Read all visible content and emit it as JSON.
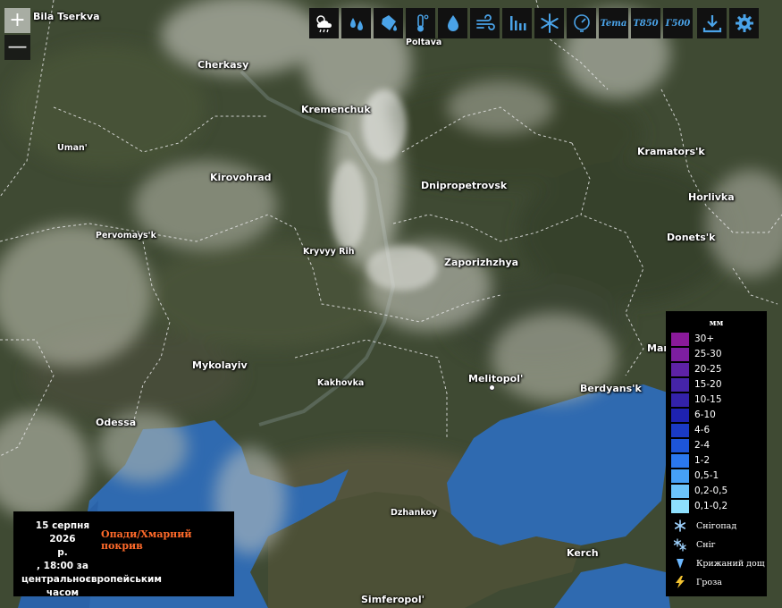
{
  "map": {
    "cities": [
      {
        "name": "Bila Tserkva"
      },
      {
        "name": "Poltava"
      },
      {
        "name": "Cherkasy"
      },
      {
        "name": "Kremenchuk"
      },
      {
        "name": "Uman'"
      },
      {
        "name": "Kirovohrad"
      },
      {
        "name": "Dnipropetrovsk"
      },
      {
        "name": "Kramators'k"
      },
      {
        "name": "Horlivka"
      },
      {
        "name": "Donets'k"
      },
      {
        "name": "Pervomays'k"
      },
      {
        "name": "Kryvyy Rih"
      },
      {
        "name": "Zaporizhzhya"
      },
      {
        "name": "Mykolayiv"
      },
      {
        "name": "Kakhovka"
      },
      {
        "name": "Melitopol'"
      },
      {
        "name": "Berdyans'k"
      },
      {
        "name": "Odessa"
      },
      {
        "name": "Dzhankoy"
      },
      {
        "name": "Kerch"
      },
      {
        "name": "Simferopol'"
      },
      {
        "name": "Mar"
      }
    ]
  },
  "zoom": {
    "in_label": "+",
    "out_label": "—"
  },
  "toolbar": {
    "items": [
      {
        "icon": "sun-cloud-rain-icon"
      },
      {
        "icon": "raindrops-icon"
      },
      {
        "icon": "bucket-icon"
      },
      {
        "icon": "thermometer-icon"
      },
      {
        "icon": "humidity-drop-icon"
      },
      {
        "icon": "wind-icon"
      },
      {
        "icon": "pressure-bars-icon"
      },
      {
        "icon": "snowflake-icon"
      },
      {
        "icon": "gauge-icon"
      },
      {
        "label": "Tema"
      },
      {
        "label": "T850"
      },
      {
        "label": "Г500"
      },
      {
        "icon": "download-icon"
      },
      {
        "icon": "settings-gear-icon"
      }
    ],
    "accent": "#4aa3e8"
  },
  "legend": {
    "unit": "мм",
    "scale": [
      {
        "label": "30+",
        "color": "#8a1a9a"
      },
      {
        "label": "25-30",
        "color": "#7d1ea0"
      },
      {
        "label": "20-25",
        "color": "#5e22a6"
      },
      {
        "label": "15-20",
        "color": "#4524a8"
      },
      {
        "label": "10-15",
        "color": "#3322aa"
      },
      {
        "label": "6-10",
        "color": "#1e22b0"
      },
      {
        "label": "4-6",
        "color": "#1a3ac4"
      },
      {
        "label": "2-4",
        "color": "#1d55d8"
      },
      {
        "label": "1-2",
        "color": "#2a78ee"
      },
      {
        "label": "0,5-1",
        "color": "#46a0f6"
      },
      {
        "label": "0,2-0,5",
        "color": "#6cc4fb"
      },
      {
        "label": "0,1-0,2",
        "color": "#8ee0fd"
      }
    ],
    "icons": [
      {
        "label": "Снігопад",
        "icon": "snowfall-icon"
      },
      {
        "label": "Сніг",
        "icon": "snow-icon"
      },
      {
        "label": "Крижаний дощ",
        "icon": "freezing-rain-icon"
      },
      {
        "label": "Гроза",
        "icon": "thunderstorm-icon"
      }
    ]
  },
  "info": {
    "date_line1": "15 серпня 2026",
    "date_line2": "р.",
    "date_line3": ", 18:00 за",
    "date_line4": "центральноєвропейським",
    "date_line5": "часом",
    "layer_title": "Опади/Хмарний покрив"
  }
}
